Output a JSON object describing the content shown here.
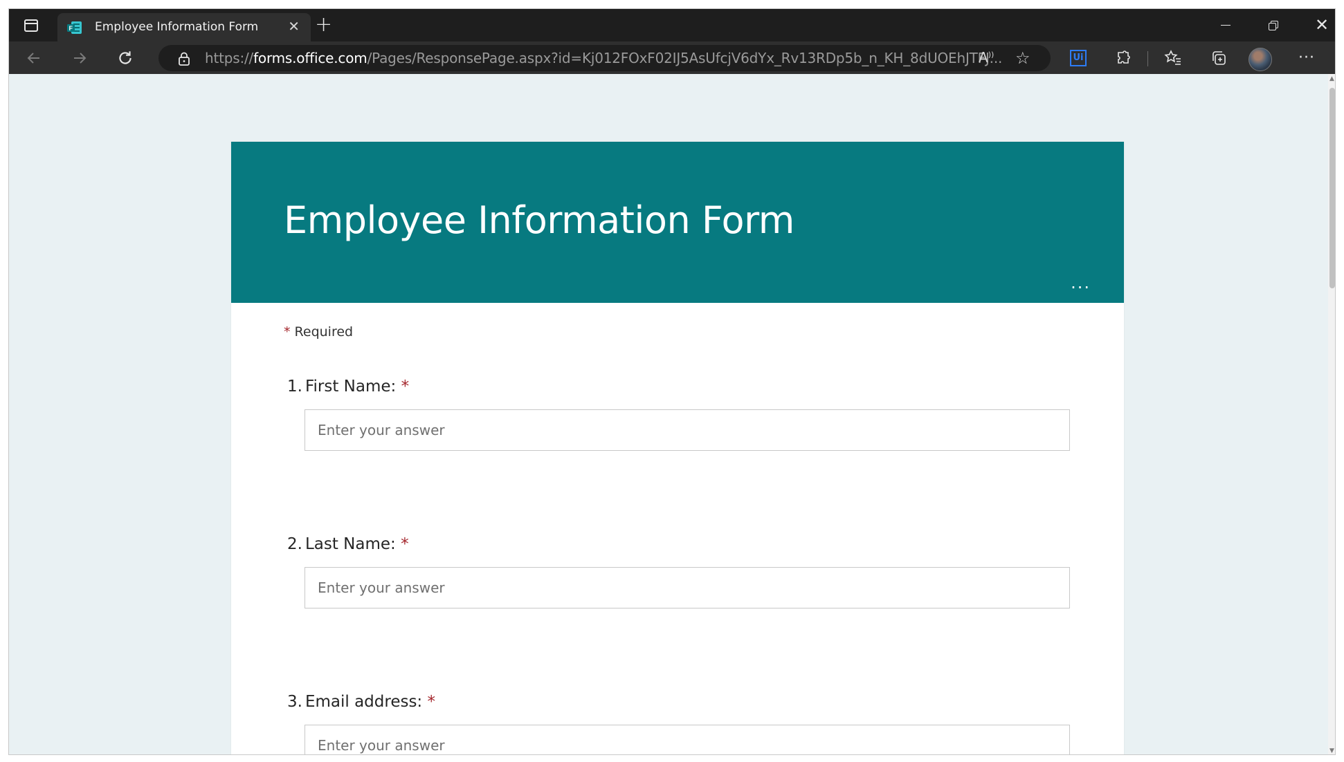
{
  "browser": {
    "tab_title": "Employee Information Form",
    "tab_close": "✕",
    "new_tab": "+",
    "url_scheme": "https://",
    "url_host": "forms.office.com",
    "url_path": "/Pages/ResponsePage.aspx?id=Kj012FOxF02IJ5AsUfcjV6dYx_Rv13RDp5b_n_KH_8dUOEhJTFJ...",
    "read_aloud": "A⁾",
    "ext_ui_label": "Ui",
    "menu_dots": "···",
    "window_close": "✕"
  },
  "form": {
    "title": "Employee Information Form",
    "more_options": "...",
    "required_asterisk": "*",
    "required_label": "Required",
    "questions": [
      {
        "number": "1.",
        "label": "First Name:",
        "required_mark": "*",
        "placeholder": "Enter your answer"
      },
      {
        "number": "2.",
        "label": "Last Name:",
        "required_mark": "*",
        "placeholder": "Enter your answer"
      },
      {
        "number": "3.",
        "label": "Email address:",
        "required_mark": "*",
        "placeholder": "Enter your answer"
      }
    ]
  },
  "theme": {
    "header_color": "#077a80",
    "page_background": "#e9f1f3",
    "required_color": "#a4262c"
  },
  "icons": [
    "tab-actions-icon",
    "forms-favicon",
    "close-icon",
    "new-tab-icon",
    "back-icon",
    "forward-icon",
    "reload-icon",
    "lock-icon",
    "read-aloud-icon",
    "add-favorite-icon",
    "puzzle-icon",
    "favorites-icon",
    "collections-icon",
    "more-icon"
  ]
}
